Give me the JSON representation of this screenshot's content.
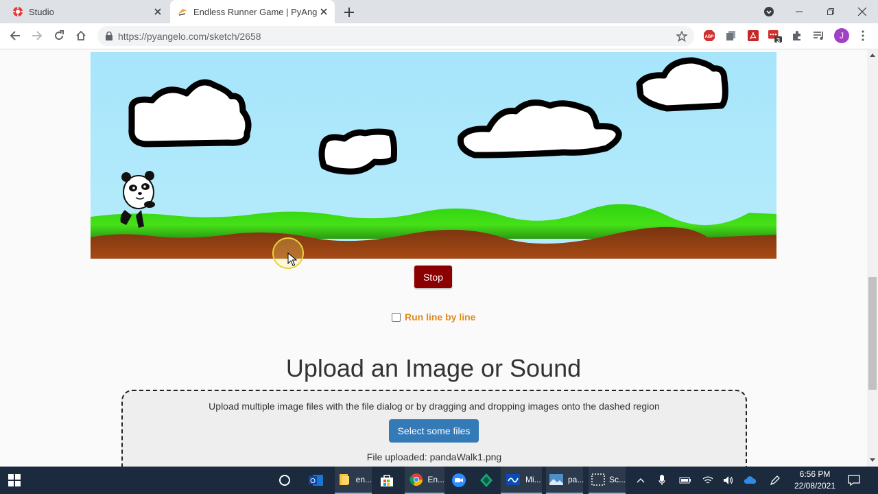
{
  "browser": {
    "tabs": [
      {
        "title": "Studio",
        "active": false
      },
      {
        "title": "Endless Runner Game | PyAngelo",
        "active": true
      }
    ],
    "url": "https://pyangelo.com/sketch/2658",
    "profile_initial": "J",
    "extension_badge": "3"
  },
  "page": {
    "stop_label": "Stop",
    "run_line_label": "Run line by line",
    "upload_heading": "Upload an Image or Sound",
    "upload_hint": "Upload multiple image files with the file dialog or by dragging and dropping images onto the dashed region",
    "select_files_label": "Select some files",
    "file_uploaded": "File uploaded: pandaWalk1.png"
  },
  "taskbar": {
    "items": [
      {
        "label": "en...",
        "icon": "file-explorer-icon"
      },
      {
        "label": "En...",
        "icon": "chrome-icon"
      },
      {
        "label": "Mi...",
        "icon": "whiteboard-icon"
      },
      {
        "label": "pa...",
        "icon": "photos-icon"
      },
      {
        "label": "Sc...",
        "icon": "snip-icon"
      }
    ],
    "time": "6:56 PM",
    "date": "22/08/2021"
  },
  "colors": {
    "sky": "#a9e4fa",
    "grass": "#3fd61a",
    "dirt": "#8a3c10",
    "stop_button": "#8b0000",
    "run_line": "#e08a1e",
    "select_button": "#337ab7"
  }
}
